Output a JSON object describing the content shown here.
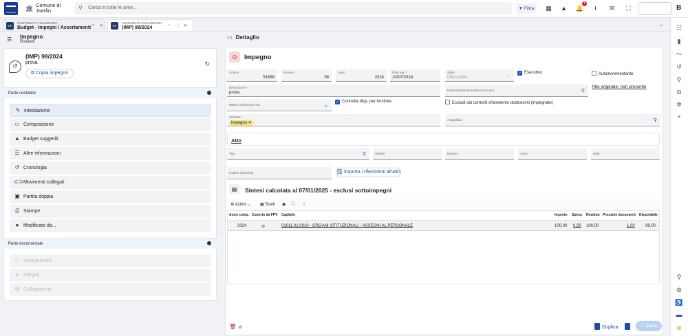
{
  "topbar": {
    "institution": "Comune di",
    "institution_line2": "Jserfin",
    "search_placeholder": "Cerca in tutte le aree...",
    "filter_label": "Filtra",
    "notification_count": "1",
    "user_initial": "B"
  },
  "tabs": [
    {
      "module": "CONTABILITÀ FINANZIARIA",
      "title": "Budget - Impegni / Accertamenti"
    },
    {
      "module": "CONTABILITÀ FINANZIARIA",
      "title": "(IMP) 98/2024"
    }
  ],
  "left": {
    "header_title": "Impegno",
    "header_sub": "Risultati",
    "card_title": "(IMP) 98/2024",
    "card_sub": "prova",
    "copy_label": "Copia impegno",
    "section1": "Parte contabile",
    "menu1": [
      {
        "label": "Intestazione"
      },
      {
        "label": "Composizione"
      },
      {
        "label": "Budget suggeriti"
      },
      {
        "label": "Altre informazioni"
      },
      {
        "label": "Cronologia"
      },
      {
        "label": "Movimenti collegati"
      },
      {
        "label": "Partita doppia"
      },
      {
        "label": "Stampe"
      },
      {
        "label": "Modificato da..."
      }
    ],
    "section2": "Parte documentale",
    "menu2": [
      {
        "label": "Assegnazioni"
      },
      {
        "label": "Allegati"
      },
      {
        "label": "Collegamenti"
      }
    ]
  },
  "detail": {
    "header": "Dettaglio",
    "title": "Impegno",
    "fields": {
      "codice": {
        "label": "Codice",
        "value": "51688"
      },
      "numero": {
        "label": "Numero",
        "value": "98"
      },
      "anno": {
        "label": "Anno",
        "value": "2024"
      },
      "data_reg": {
        "label": "Data reg.",
        "value": "10/07/2024"
      },
      "stato": {
        "label": "Stato",
        "value": "Utilizzabile"
      },
      "descrizione": {
        "label": "Descrizione",
        "value": "prova"
      },
      "responsabile": {
        "label": "Responsabile procedimento (cap.)",
        "value": ""
      },
      "motivo": {
        "label": "Motivo esclusione CIG",
        "value": ""
      },
      "etichette": {
        "label": "etichette",
        "chip": "impegno"
      },
      "anagrafica": {
        "label": "Anagrafica",
        "value": ""
      },
      "tipo": {
        "label": "Tipo"
      },
      "settore": {
        "label": "Settore"
      },
      "numero_atto": {
        "label": "Numero"
      },
      "anno_atto": {
        "label": "Anno"
      },
      "data_atto": {
        "label": "Data"
      },
      "codice_determina": {
        "label": "Codice determina"
      }
    },
    "checks": {
      "esecutivo": "Esecutivo",
      "autoincrementante": "Autoincrementante",
      "controlla": "Controlla disp. per fornitore",
      "escludi": "Escludi dai controlli sforamento dodicesimi (impegnato)"
    },
    "atto_originale": "Atto originale: non presente",
    "atto_title": "Atto",
    "import_label": "Importa i riferimenti all'atto",
    "sintesi_title": "Sintesi calcolata al 07/01/2025 - esclusi sottoimpegni",
    "toolbar": {
      "azioni": "Azioni",
      "totali": "Totali"
    },
    "table": {
      "headers": [
        "Anno comp.",
        "Coperto da FPV",
        "Capitolo",
        "Importo",
        "Speso",
        "Residuo",
        "Prossimi documenti",
        "Disponibile"
      ],
      "row": {
        "anno": "2024",
        "capitolo": "01011.01.0010 - ORGANI ISTITUZIONALI - ASSEGNI AL PERSONALE",
        "importo": "100,00",
        "speso": "0,00",
        "residuo": "100,00",
        "prossimi": "1,00",
        "disponibile": "99,00"
      }
    },
    "footer": {
      "duplica": "Duplica",
      "salva": "Salva"
    }
  },
  "colors": {
    "accent": "#1a4fa0",
    "danger": "#c21c1c",
    "chip": "#f7e57a"
  }
}
